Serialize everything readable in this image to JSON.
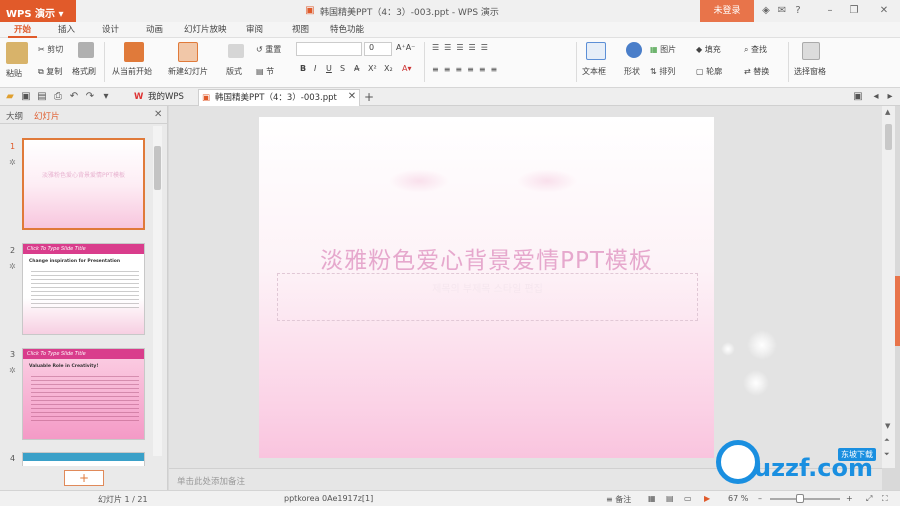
{
  "app": {
    "logo_label": "WPS 演示",
    "doc_title": "韩国精美PPT（4：3）-003.ppt - WPS 演示",
    "login_label": "未登录"
  },
  "menu": {
    "tabs": [
      "开始",
      "插入",
      "设计",
      "动画",
      "幻灯片放映",
      "审阅",
      "视图",
      "特色功能"
    ]
  },
  "ribbon": {
    "paste": "粘贴",
    "cut": "剪切",
    "copy": "复制",
    "format_painter": "格式刷",
    "from_current": "从当前开始",
    "new_slide": "新建幻灯片",
    "layout": "版式",
    "section": "节",
    "reset": "重置",
    "font_size": "0",
    "textbox": "文本框",
    "shape": "形状",
    "arrange": "排列",
    "picture": "图片",
    "fill": "填充",
    "outline": "轮廓",
    "find": "查找",
    "replace": "替换",
    "select_pane": "选择窗格"
  },
  "tabstrip": {
    "my_wps": "我的WPS",
    "doc_tab": "韩国精美PPT（4：3）-003.ppt"
  },
  "left_panel": {
    "tab_outline": "大纲",
    "tab_slides": "幻灯片",
    "slide_numbers": [
      "1",
      "2",
      "3",
      "4"
    ],
    "thumb2_title": "Click To Type Slide Title",
    "thumb2_heading": "Change inspiration for Presentation",
    "thumb3_title": "Click To Type Slide Title",
    "thumb3_heading": "Valuable Role in Creativity!"
  },
  "slide": {
    "title": "淡雅粉色爱心背景爱情PPT模板",
    "subtitle": "제목의 부제목 스타일 편집"
  },
  "notes": {
    "placeholder": "单击此处添加备注"
  },
  "status": {
    "slide_counter": "幻灯片 1 / 21",
    "theme": "pptkorea 0Ae1917z[1]",
    "notes_label": "备注",
    "zoom": "67 %"
  },
  "watermark": {
    "text": "uzzf.com",
    "tag": "东坡下载"
  }
}
